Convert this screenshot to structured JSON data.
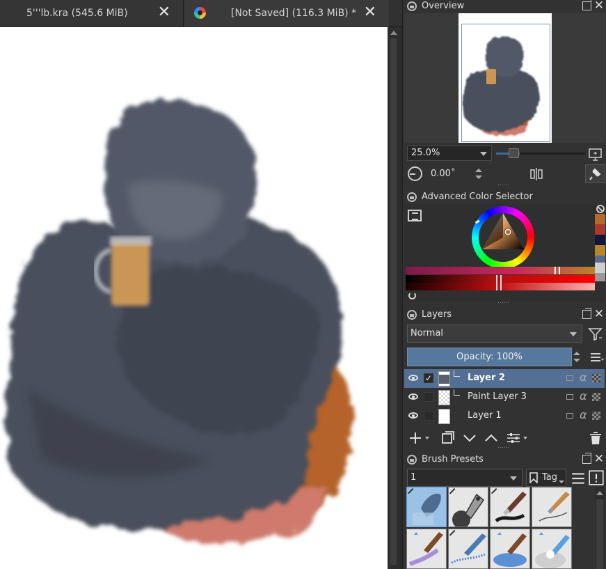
{
  "tabs": [
    {
      "label": "5'''lb.kra (545.6 MiB)",
      "close": "✕"
    },
    {
      "label": "[Not Saved]  (116.3 MiB) *",
      "close": "✕"
    }
  ],
  "overview": {
    "title": "Overview",
    "zoom": "25.0%",
    "rotation": "0.00˚"
  },
  "color_selector": {
    "title": "Advanced Color Selector",
    "swatches": [
      "#b46a2a",
      "#a9392a",
      "#14163a",
      "#b8862a"
    ]
  },
  "layers": {
    "title": "Layers",
    "blend_mode": "Normal",
    "opacity_label": "Opacity:  100%",
    "items": [
      {
        "name": "Layer 2",
        "selected": true,
        "checked": true
      },
      {
        "name": "Paint Layer 3",
        "selected": false,
        "checked": false
      },
      {
        "name": "Layer 1",
        "selected": false,
        "checked": false
      }
    ]
  },
  "brush_presets": {
    "title": "Brush Presets",
    "filter_value": "1",
    "tag_label": "Tag"
  },
  "colors": {
    "selection": "#536f93",
    "opacity_bar": "#56789d",
    "panel": "#323232"
  }
}
